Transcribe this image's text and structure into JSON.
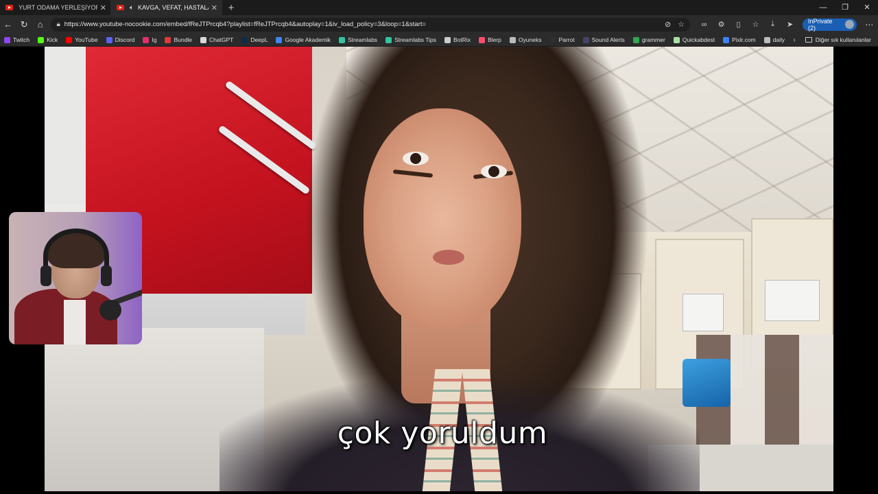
{
  "tabs": [
    {
      "title": "YURT ODAMA YERLEŞİYORUM | h",
      "active": false
    },
    {
      "title": "KAVGA, VEFAT, HASTALAR -",
      "active": true
    }
  ],
  "address": {
    "url": "https://www.youtube-nocookie.com/embed/fReJTPrcqb4?playlist=fReJTPrcqb4&autoplay=1&iv_load_policy=3&loop=1&start="
  },
  "profile": {
    "label": "InPrivate (2)"
  },
  "bookmarks": [
    {
      "label": "Twitch",
      "color": "#9146ff"
    },
    {
      "label": "Kick",
      "color": "#53fc18"
    },
    {
      "label": "YouTube",
      "color": "#ff0000"
    },
    {
      "label": "Discord",
      "color": "#5865f2"
    },
    {
      "label": "Ig",
      "color": "#e1306c"
    },
    {
      "label": "Bundle",
      "color": "#e03a3a"
    },
    {
      "label": "ChatGPT",
      "color": "#d9d9d9"
    },
    {
      "label": "DeepL",
      "color": "#0f2b46"
    },
    {
      "label": "Google Akademik",
      "color": "#4285f4"
    },
    {
      "label": "Streamlabs",
      "color": "#31c3a2"
    },
    {
      "label": "Streamlabs Tips",
      "color": "#31c3a2"
    },
    {
      "label": "BotRix",
      "color": "#cccccc"
    },
    {
      "label": "Blerp",
      "color": "#ff4d6d"
    },
    {
      "label": "Oyuneks",
      "color": "#bbbbbb"
    },
    {
      "label": "Parrot",
      "color": "#2f2f2f"
    },
    {
      "label": "Sound Alerts",
      "color": "#444466"
    },
    {
      "label": "grammer",
      "color": "#2fa84f"
    },
    {
      "label": "Quickabdest",
      "color": "#a6e3a1"
    },
    {
      "label": "Pixlr.com",
      "color": "#3b82f6"
    },
    {
      "label": "daily",
      "color": "#bbbbbb"
    }
  ],
  "other_bookmarks": "Diğer sık kullanılanlar",
  "subtitle": "çok yoruldum"
}
